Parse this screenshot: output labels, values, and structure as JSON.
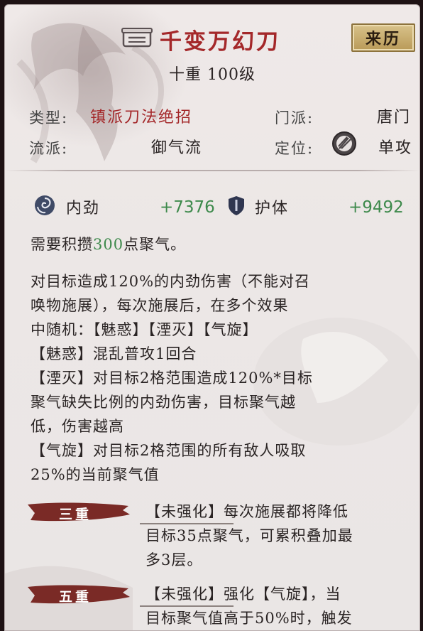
{
  "skill": {
    "name": "千变万幻刀",
    "origin_button": "来历",
    "level_text": "十重 100级"
  },
  "attributes": {
    "type_label": "类型:",
    "type_value": "镇派刀法绝招",
    "sect_label": "门派:",
    "sect_value": "唐门",
    "school_label": "流派:",
    "school_value": "御气流",
    "role_label": "定位:",
    "role_value": "单攻"
  },
  "stats": {
    "inner_label": "内劲",
    "inner_value": "+7376",
    "guard_label": "护体",
    "guard_value": "+9492"
  },
  "cost": {
    "prefix": "需要积攒",
    "amount": "300",
    "suffix": "点聚气。"
  },
  "description": [
    "对目标造成120%的内劲伤害（不能对召",
    "唤物施展），每次施展后，在多个效果",
    "中随机：【魅惑】【湮灭】【气旋】",
    "【魅惑】混乱普攻1回合",
    "【湮灭】对目标2格范围造成120%*目标",
    "聚气缺失比例的内劲伤害，目标聚气越",
    "低，伤害越高",
    "【气旋】对目标2格范围的所有敌人吸取",
    "25%的当前聚气值"
  ],
  "tiers": [
    {
      "label": "三重",
      "lines": [
        "【未强化】每次施展都将降低",
        "目标35点聚气，可累积叠加最",
        "多3层。"
      ]
    },
    {
      "label": "五重",
      "lines": [
        "【未强化】强化【气旋】，当",
        "目标聚气值高于50%时，触发"
      ]
    }
  ],
  "colors": {
    "title_red": "#a4282a",
    "stat_green": "#3e8a4c",
    "origin_gold": "#c9ad6e",
    "tier_tag": "#7a2a26"
  },
  "icons": {
    "title": "scroll-book-icon",
    "role": "single-target-icon",
    "inner": "swirl-energy-icon",
    "guard": "shield-icon"
  }
}
